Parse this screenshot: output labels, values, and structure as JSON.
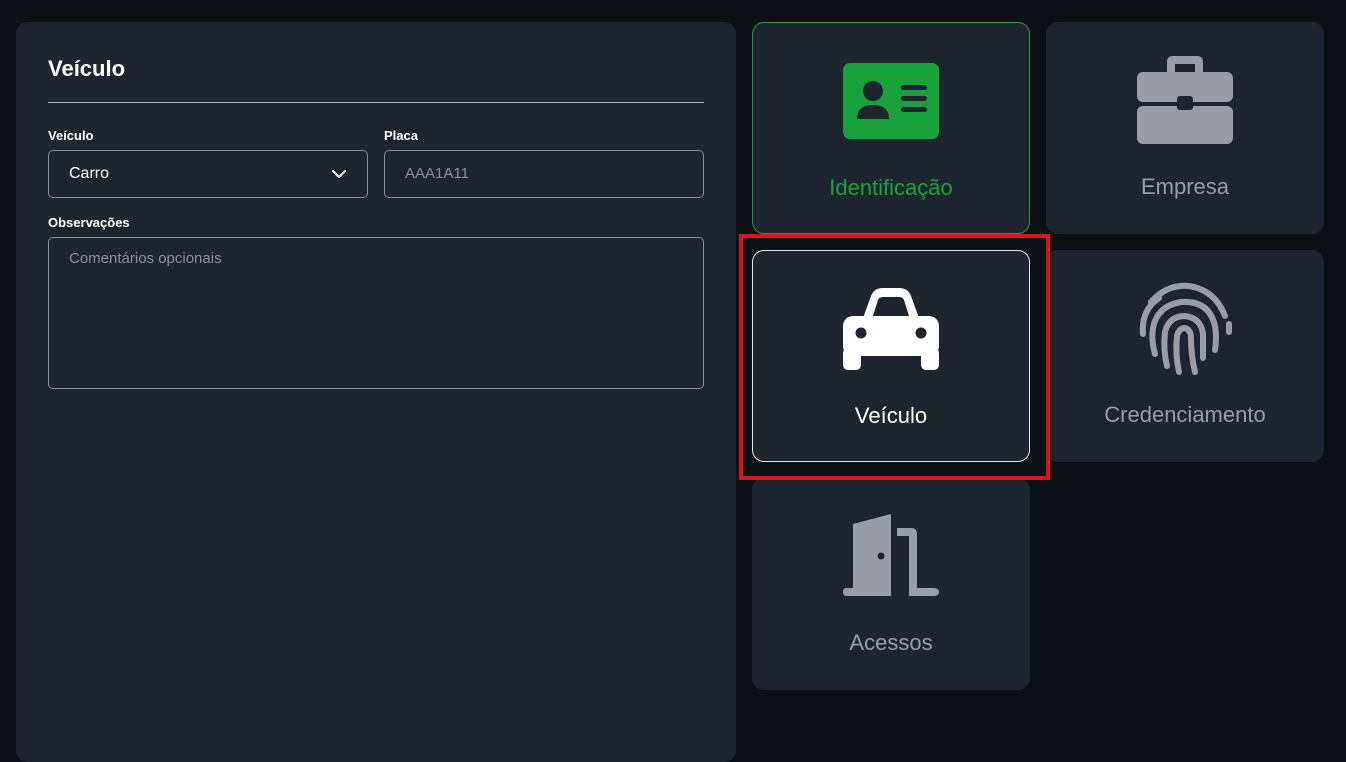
{
  "form": {
    "title": "Veículo",
    "vehicle_label": "Veículo",
    "vehicle_value": "Carro",
    "plate_label": "Placa",
    "plate_placeholder": "AAA1A11",
    "notes_label": "Observações",
    "notes_placeholder": "Comentários opcionais"
  },
  "tiles": [
    {
      "label": "Identificação",
      "icon": "id-card-icon",
      "color": "#1aa13c"
    },
    {
      "label": "Empresa",
      "icon": "briefcase-icon",
      "color": "#9a9da3"
    },
    {
      "label": "Veículo",
      "icon": "car-icon",
      "color": "#ffffff"
    },
    {
      "label": "Credenciamento",
      "icon": "fingerprint-icon",
      "color": "#9a9da3"
    },
    {
      "label": "Acessos",
      "icon": "door-open-icon",
      "color": "#9a9da3"
    }
  ],
  "colors": {
    "background": "#0d1015",
    "panel": "#1f252f",
    "accent_green": "#1aa13c",
    "highlight_red": "#e0121d"
  }
}
